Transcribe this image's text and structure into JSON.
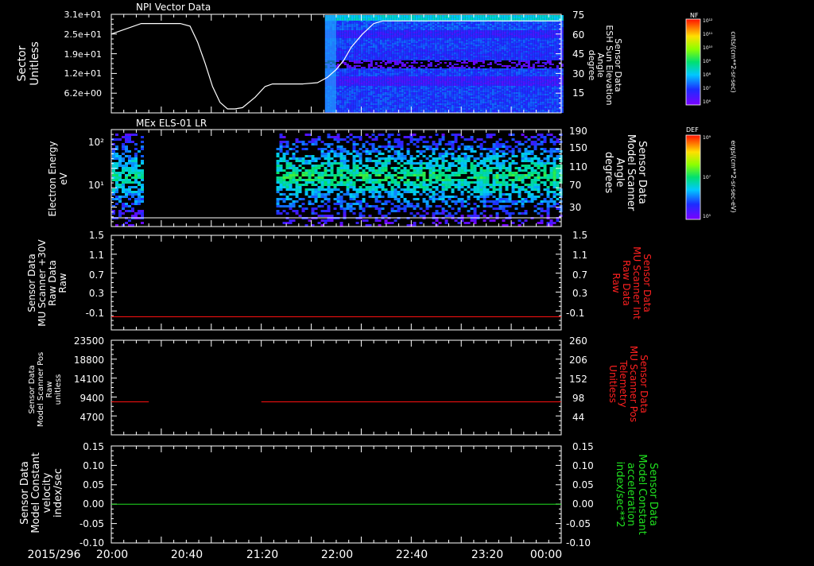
{
  "chart_data": [
    {
      "type": "heatmap",
      "panel": "npi",
      "title": "NPI Vector Data",
      "ylabel_lines": [
        "Sector",
        "Unitless"
      ],
      "y_ticks": [
        "3.1e+01",
        "2.5e+01",
        "1.9e+01",
        "1.2e+01",
        "6.2e+00"
      ],
      "y2_ticks": [
        "75",
        "60",
        "45",
        "30",
        "15"
      ],
      "y2label_lines": [
        "Sensor Data",
        "ESH Sun Elevation",
        "Angle",
        "degree"
      ],
      "colorbar": {
        "name": "NF",
        "tick_labels": [
          "10¹²",
          "10¹¹",
          "10¹⁰",
          "10⁹",
          "10⁸",
          "10⁷",
          "10⁶"
        ],
        "units": "cnts/(cm**2-sr-sec)"
      },
      "overlay_line": {
        "name": "ESH Sun Elevation Angle",
        "y2_range": [
          0,
          75
        ],
        "x_hours": [
          0.0,
          0.4,
          0.92,
          1.05,
          1.15,
          1.25,
          1.35,
          1.45,
          1.55,
          1.65,
          1.75,
          1.92,
          2.05,
          2.15,
          2.25,
          2.35,
          2.55,
          2.75,
          2.88,
          3.0,
          3.1,
          3.2,
          3.35,
          3.5,
          3.62,
          3.8,
          4.2,
          4.6,
          5.0,
          5.4,
          5.9,
          6.0
        ],
        "y2": [
          60,
          68,
          68,
          66,
          54,
          38,
          20,
          8,
          3,
          3,
          4,
          12,
          20,
          22,
          22,
          22,
          22,
          23,
          27,
          33,
          40,
          50,
          60,
          68,
          70,
          70,
          70,
          70,
          70,
          70,
          70,
          70
        ]
      }
    },
    {
      "type": "heatmap",
      "panel": "els",
      "title": "MEx ELS-01 LR",
      "ylabel_lines": [
        "Electron Energy",
        "eV"
      ],
      "y_ticks": [
        "10²",
        "10¹"
      ],
      "y2_ticks": [
        "190",
        "150",
        "110",
        "70",
        "30"
      ],
      "y2label_lines": [
        "Sensor Data",
        "Model Scanner",
        "Angle",
        "degrees"
      ],
      "colorbar": {
        "name": "DEF",
        "tick_labels": [
          "10⁹",
          "10⁷",
          "10⁵"
        ],
        "units": "ergs/(cm**2-sr-sec-eV)"
      }
    },
    {
      "type": "line",
      "panel": "mu30",
      "ylabel_lines": [
        "Sensor Data",
        "MU Scanner +30V",
        "Raw Data",
        "Raw"
      ],
      "y_ticks": [
        "1.5",
        "1.1",
        "0.7",
        "0.3",
        "-0.1"
      ],
      "y2_ticks": [
        "1.5",
        "1.1",
        "0.7",
        "0.3",
        "-0.1"
      ],
      "y2label_lines": [
        "Sensor Data",
        "MU Scanner Int",
        "Raw Data",
        "Raw"
      ],
      "ylim": [
        -0.3,
        1.5
      ],
      "series": [
        {
          "color": "#ff1010",
          "segments": [
            {
              "x": [
                0.0,
                6.0
              ],
              "y": [
                -0.05,
                -0.05
              ]
            }
          ]
        }
      ]
    },
    {
      "type": "line",
      "panel": "scanpos",
      "ylabel_lines": [
        "Sensor Data",
        "Model Scanner Pos",
        "Raw",
        "unitless"
      ],
      "y_ticks": [
        "23500",
        "18800",
        "14100",
        "9400",
        "4700"
      ],
      "y2_ticks": [
        "260",
        "206",
        "152",
        "98",
        "44"
      ],
      "y2label_lines": [
        "Sensor Data",
        "MU Scanner Pos",
        "Telemetry",
        "Unitless"
      ],
      "ylim": [
        0,
        23500
      ],
      "series": [
        {
          "color": "#ff1010",
          "segments": [
            {
              "x": [
                0.0,
                0.5
              ],
              "y": [
                8200,
                8200
              ]
            },
            {
              "x": [
                2.0,
                6.0
              ],
              "y": [
                8200,
                8200
              ]
            }
          ]
        }
      ]
    },
    {
      "type": "line",
      "panel": "velocity",
      "ylabel_lines": [
        "Sensor Data",
        "Model Constant",
        "velocity",
        "index/sec"
      ],
      "y_ticks": [
        "0.15",
        "0.10",
        "0.05",
        "0.00",
        "-0.05",
        "-0.10"
      ],
      "y2_ticks": [
        "0.15",
        "0.10",
        "0.05",
        "0.00",
        "-0.05",
        "-0.10"
      ],
      "y2label_lines": [
        "Sensor Data",
        "Model Constant",
        "acceleration",
        "index/sec**2"
      ],
      "ylim": [
        -0.1,
        0.15
      ],
      "series": [
        {
          "color": "#20e020",
          "segments": [
            {
              "x": [
                0.0,
                6.0
              ],
              "y": [
                0.0,
                0.0
              ]
            }
          ]
        }
      ]
    }
  ],
  "x_axis": {
    "date_label": "2015/296",
    "ticks": [
      "20:00",
      "20:40",
      "21:20",
      "22:00",
      "22:40",
      "23:20",
      "00:00"
    ]
  },
  "colors": {
    "axes": "#ffffff",
    "background": "#000000",
    "label_red": "#ff2020",
    "label_green": "#20e020"
  }
}
